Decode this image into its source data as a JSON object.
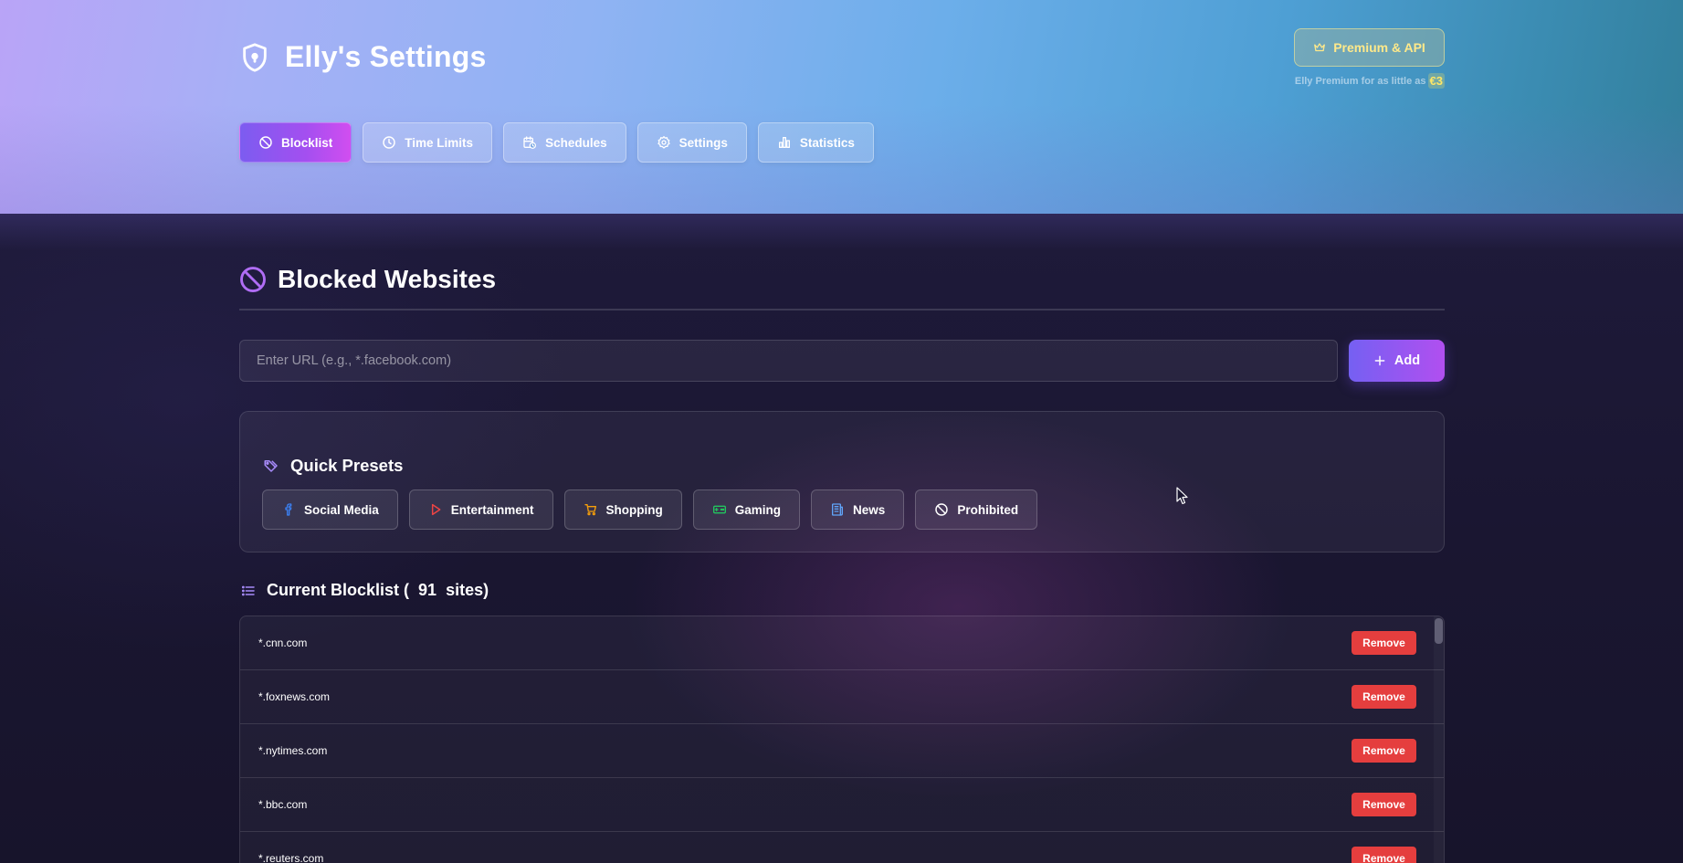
{
  "header": {
    "title": "Elly's Settings",
    "premium_button": "Premium & API",
    "premium_note": "Elly Premium for as little as",
    "premium_price": "€3"
  },
  "tabs": [
    {
      "label": "Blocklist",
      "icon": "ban-icon",
      "active": true
    },
    {
      "label": "Time Limits",
      "icon": "clock-icon",
      "active": false
    },
    {
      "label": "Schedules",
      "icon": "calendar-clock-icon",
      "active": false
    },
    {
      "label": "Settings",
      "icon": "gear-icon",
      "active": false
    },
    {
      "label": "Statistics",
      "icon": "bar-chart-icon",
      "active": false
    }
  ],
  "blocked": {
    "title": "Blocked Websites",
    "input_placeholder": "Enter URL (e.g., *.facebook.com)",
    "add_label": "Add"
  },
  "presets": {
    "title": "Quick Presets",
    "items": [
      {
        "label": "Social Media",
        "icon": "facebook-icon",
        "color": "#3b82f6"
      },
      {
        "label": "Entertainment",
        "icon": "play-icon",
        "color": "#ef4444"
      },
      {
        "label": "Shopping",
        "icon": "cart-icon",
        "color": "#f59e0b"
      },
      {
        "label": "Gaming",
        "icon": "gamepad-icon",
        "color": "#22c55e"
      },
      {
        "label": "News",
        "icon": "newspaper-icon",
        "color": "#60a5fa"
      },
      {
        "label": "Prohibited",
        "icon": "ban-icon",
        "color": "#ffffff"
      }
    ]
  },
  "blocklist": {
    "title_prefix": "Current Blocklist (",
    "count": "91",
    "title_suffix": "sites)",
    "remove_label": "Remove",
    "items": [
      "*.cnn.com",
      "*.foxnews.com",
      "*.nytimes.com",
      "*.bbc.com",
      "*.reuters.com"
    ]
  },
  "colors": {
    "accent_purple": "#a855f7",
    "remove_red": "#e53e3e",
    "premium_gold": "#ffe98a"
  }
}
